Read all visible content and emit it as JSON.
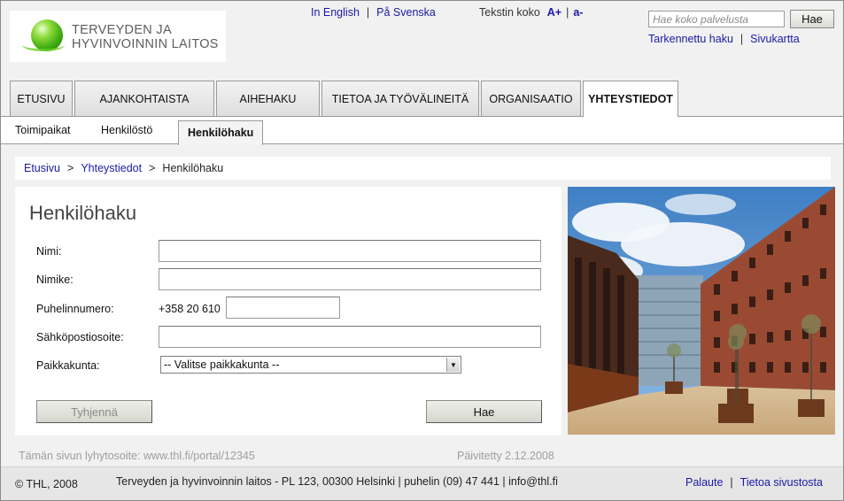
{
  "logo": {
    "text": "TERVEYDEN JA\nHYVINVOINNIN LAITOS"
  },
  "header": {
    "lang_english": "In English",
    "lang_swedish": "På Svenska",
    "textsize_label": "Tekstin koko",
    "textsize_bigger": "A+",
    "textsize_smaller": "a-",
    "search_placeholder": "Hae koko palvelusta",
    "search_button": "Hae",
    "advanced_search": "Tarkennettu haku",
    "sitemap": "Sivukartta"
  },
  "tabs": [
    {
      "label": "ETUSIVU"
    },
    {
      "label": "AJANKOHTAISTA"
    },
    {
      "label": "AIHEHAKU"
    },
    {
      "label": "TIETOA JA TYÖVÄLINEITÄ"
    },
    {
      "label": "ORGANISAATIO"
    },
    {
      "label": "YHTEYSTIEDOT"
    }
  ],
  "active_tab": "YHTEYSTIEDOT",
  "subtabs": [
    {
      "label": "Toimipaikat"
    },
    {
      "label": "Henkilöstö"
    },
    {
      "label": "Henkilöhaku"
    }
  ],
  "breadcrumb": {
    "home": "Etusivu",
    "parent": "Yhteystiedot",
    "current": "Henkilöhaku"
  },
  "form": {
    "title": "Henkilöhaku",
    "name_label": "Nimi:",
    "name_value": "",
    "jobtitle_label": "Nimike:",
    "jobtitle_value": "",
    "phone_label": "Puhelinnumero:",
    "phone_prefix": "+358 20 610",
    "phone_value": "",
    "email_label": "Sähköpostiosoite:",
    "email_value": "",
    "city_label": "Paikkakunta:",
    "city_selected": "-- Valitse paikkakunta --",
    "clear_button": "Tyhjennä",
    "search_button": "Hae"
  },
  "meta": {
    "short_address": "Tämän sivun lyhytosoite: www.thl.fi/portal/12345",
    "updated": "Päivitetty 2.12.2008"
  },
  "footer": {
    "copyright": "© THL, 2008",
    "address": "Terveyden ja hyvinvoinnin laitos - PL 123, 00300 Helsinki | puhelin (09) 47 441 | info@thl.fi",
    "feedback": "Palaute",
    "about": "Tietoa sivustosta"
  },
  "icons": {
    "select_arrow": "chevron-down-icon",
    "logo": "green-sphere-logo"
  }
}
